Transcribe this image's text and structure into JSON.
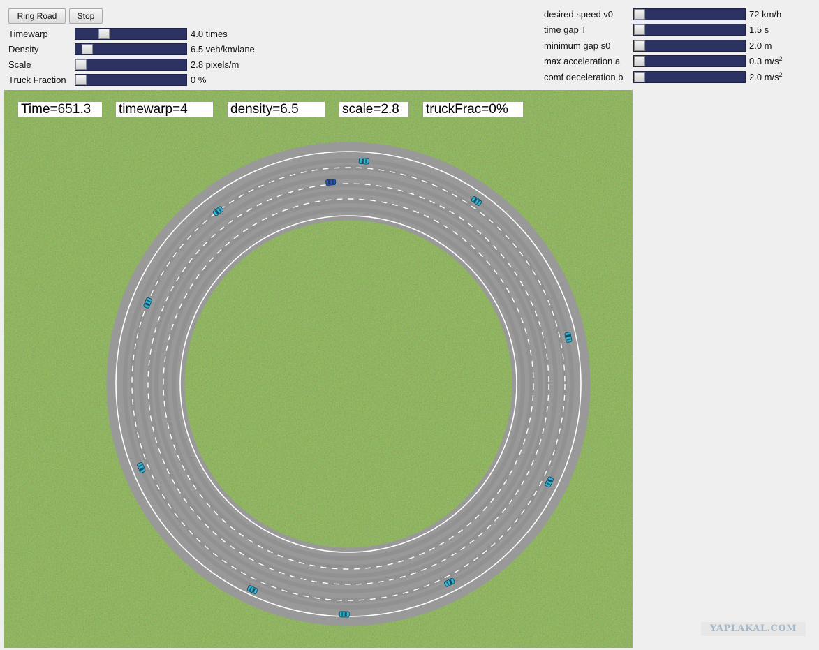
{
  "buttons": {
    "ring_road": "Ring Road",
    "stop": "Stop"
  },
  "left_sliders": [
    {
      "label": "Timewarp",
      "value": "4.0 times",
      "position": 0.23
    },
    {
      "label": "Density",
      "value": "6.5 veh/km/lane",
      "position": 0.06
    },
    {
      "label": "Scale",
      "value": "2.8 pixels/m",
      "position": 0.0
    },
    {
      "label": "Truck Fraction",
      "value": "0 %",
      "position": 0.0
    }
  ],
  "right_sliders": [
    {
      "label": "desired speed v0",
      "value": "72 km/h",
      "position": 0.0
    },
    {
      "label": "time gap T",
      "value": "1.5 s",
      "position": 0.0
    },
    {
      "label": "minimum gap s0",
      "value": "2.0 m",
      "position": 0.0
    },
    {
      "label": "max acceleration a",
      "value": "0.3 m/s",
      "sup": "2",
      "position": 0.0
    },
    {
      "label": "comf deceleration b",
      "value": "2.0 m/s",
      "sup": "2",
      "position": 0.0
    }
  ],
  "info_boxes": [
    {
      "text": "Time=651.3"
    },
    {
      "text": "timewarp=4"
    },
    {
      "text": "density=6.5"
    },
    {
      "text": "scale=2.8"
    },
    {
      "text": "truckFrac=0%"
    }
  ],
  "colors": {
    "grass": "#4a6a28",
    "road": "#999999",
    "car": "#2fb8d6",
    "car_highlight": "#2c4fb8",
    "slider_track": "#2c3363"
  },
  "watermark": "YAPLAKAL.COM"
}
